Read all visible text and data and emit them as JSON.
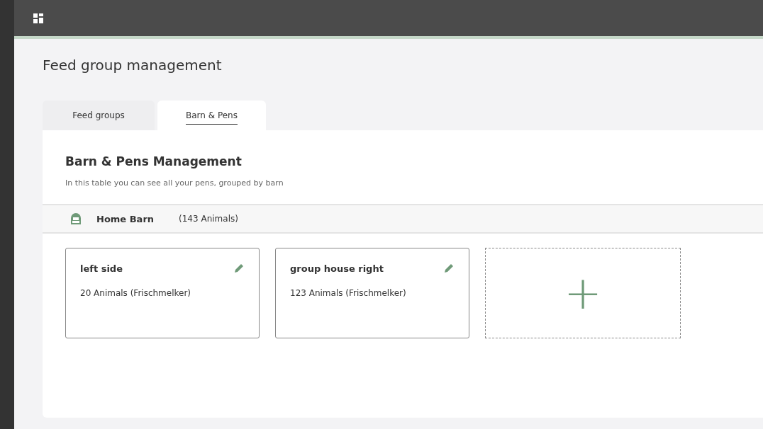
{
  "page_title": "Feed group management",
  "tabs": [
    {
      "label": "Feed groups",
      "selected": false
    },
    {
      "label": "Barn & Pens",
      "selected": true
    }
  ],
  "panel": {
    "title": "Barn & Pens Management",
    "description": "In this table you can see all your pens, grouped by barn"
  },
  "barns": [
    {
      "name": "Home Barn",
      "count": "(143 Animals)",
      "pens": [
        {
          "name": "left side",
          "animals": "20 Animals (Frischmelker)"
        },
        {
          "name": "group house right",
          "animals": "123 Animals (Frischmelker)"
        }
      ],
      "add_label": "+"
    }
  ]
}
